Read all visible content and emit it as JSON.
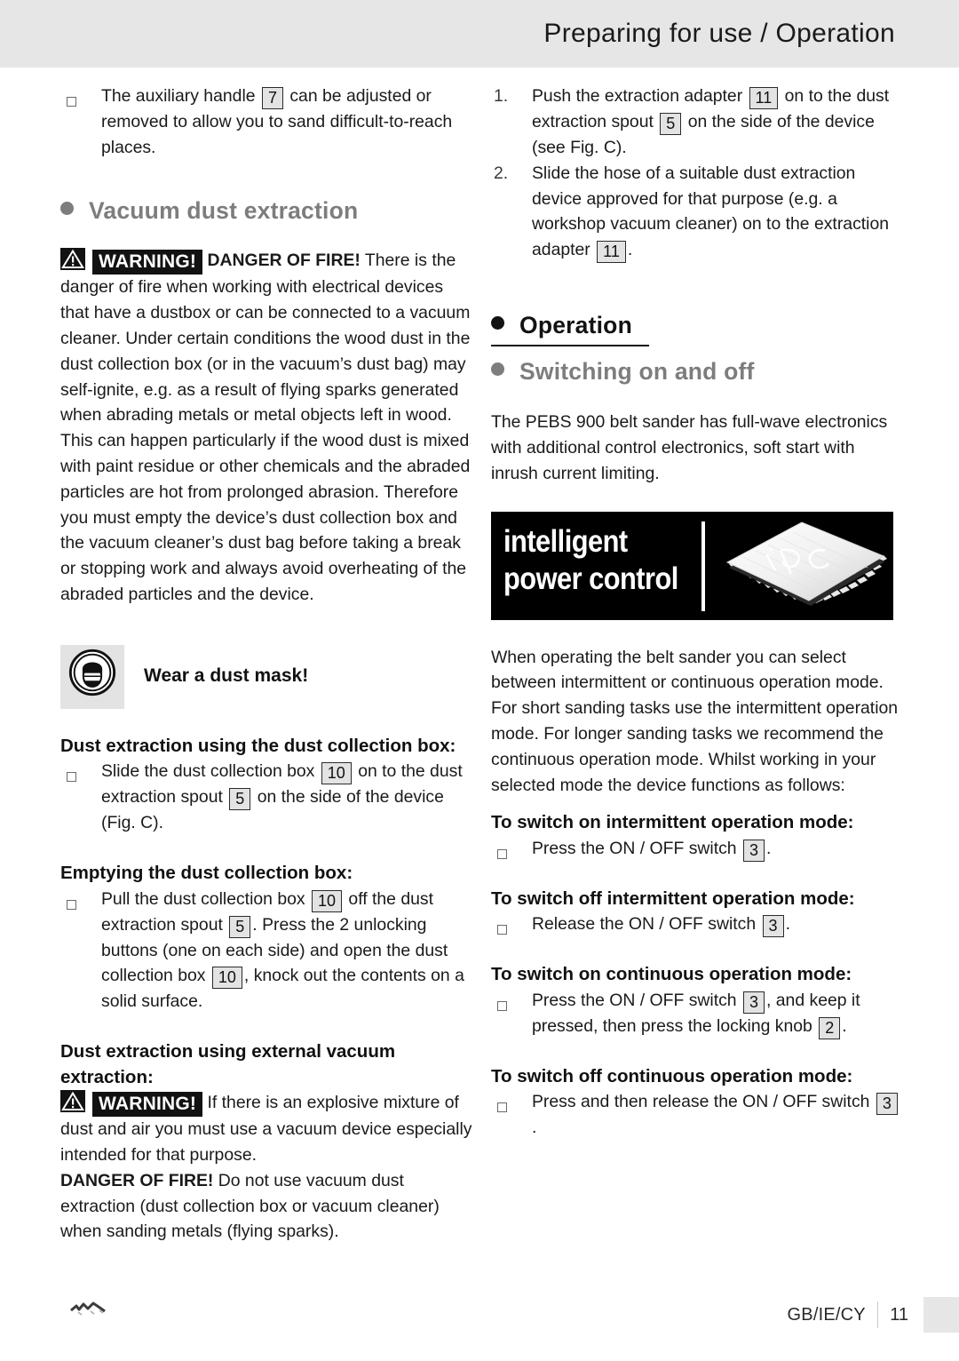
{
  "header": {
    "title": "Preparing for use / Operation"
  },
  "colors": {
    "header_band": "#e6e6e6",
    "heading_gray": "#7d7d7d",
    "heading_black": "#121212",
    "refbox_fill": "#e3e3e3",
    "warning_tag_bg": "#121212",
    "logo_bg": "#000000"
  },
  "left_column": {
    "bullet_auxiliary_handle": {
      "marker": "square-bullet",
      "text_1": "The auxiliary handle",
      "ref_1": "7",
      "text_2": "can be adjusted or removed to allow you to sand difficult-to-reach places."
    },
    "heading_vacuum_dust_extraction": "Vacuum dust extraction",
    "warning_fire": {
      "icon": "warning-triangle-icon",
      "tag": "WARNING!",
      "lead": "DANGER OF FIRE!",
      "body": "There is the danger of fire when working with electrical devices that have a dustbox or can be connected to a vacuum cleaner. Under certain conditions the wood dust in the dust collection box (or in the vacuum’s dust bag) may self-ignite, e.g. as a result of flying sparks generated when abrading metals or metal objects left in wood. This can happen particularly if the wood dust is mixed with paint residue or other chemicals and the abraded particles are hot from prolonged abrasion. Therefore you must empty the device’s dust collection box and the vacuum cleaner’s dust bag before taking a break or stopping work and always avoid overheating of the abraded particles and the device."
    },
    "dust_mask": {
      "icon": "dust-mask-pictogram-icon",
      "label": "Wear a dust mask!"
    },
    "heading_dust_collection_box": "Dust extraction using the dust collection box:",
    "bullet_slide_box": {
      "text_1": "Slide the dust collection box",
      "ref_1": "10",
      "text_2": "on to the dust extraction spout",
      "ref_2": "5",
      "text_3": "on the side of the device (Fig. C)."
    },
    "heading_emptying_box": "Emptying the dust collection box:",
    "bullet_pull_box": {
      "text_1": "Pull the dust collection box",
      "ref_1": "10",
      "text_2": "off the dust extraction spout",
      "ref_2": "5",
      "text_3": ". Press the 2 unlocking buttons (one on each side) and open the dust collection box",
      "ref_3": "10",
      "text_4": ", knock out the contents on a solid surface."
    },
    "heading_external_vacuum": "Dust extraction using external vacuum extraction:",
    "warning_explosive": {
      "icon": "warning-triangle-icon",
      "tag": "WARNING!",
      "body": "If there is an explosive mixture of dust and air you must use a vacuum device especially intended for that purpose."
    },
    "danger_fire_note": {
      "lead": "DANGER OF FIRE!",
      "body": "Do not use vacuum dust extraction (dust collection box or vacuum cleaner) when sanding metals (flying sparks)."
    }
  },
  "right_column": {
    "step_1": {
      "marker": "1.",
      "text_1": "Push the extraction adapter",
      "ref_1": "11",
      "text_2": "on to the dust extraction spout",
      "ref_2": "5",
      "text_3": "on the side of the device (see Fig. C)."
    },
    "step_2": {
      "marker": "2.",
      "text_1": "Slide the hose of a suitable dust extraction device approved for that purpose (e.g. a workshop vacuum cleaner) on to the extraction adapter",
      "ref_1": "11",
      "text_2": "."
    },
    "heading_operation": "Operation",
    "heading_switching": "Switching on and off",
    "intro_paragraph": "The PEBS 900 belt sander has full-wave electronics with additional control electronics, soft start with inrush current limiting.",
    "logo": {
      "line_1": "intelligent",
      "line_2": "power control",
      "chip_label": "ipc",
      "alt": "intelligent-power-control-logo"
    },
    "mode_paragraph": "When operating the belt sander you can select between intermittent or continuous operation mode. For short sanding tasks use the intermittent operation mode. For longer sanding tasks we recommend the continuous operation mode. Whilst working in your selected mode the device functions as follows:",
    "heading_on_intermittent": "To switch on intermittent operation mode:",
    "bullet_on_intermittent": {
      "text_1": "Press the ON / OFF switch",
      "ref_1": "3",
      "text_2": "."
    },
    "heading_off_intermittent": "To switch off intermittent operation mode:",
    "bullet_off_intermittent": {
      "text_1": "Release the ON / OFF switch",
      "ref_1": "3",
      "text_2": "."
    },
    "heading_on_continuous": "To switch on continuous operation mode:",
    "bullet_on_continuous": {
      "text_1": "Press the ON / OFF switch",
      "ref_1": "3",
      "text_2": ", and keep it pressed, then press the locking knob",
      "ref_2": "2",
      "text_3": "."
    },
    "heading_off_continuous": "To switch off continuous operation mode:",
    "bullet_off_continuous": {
      "text_1": "Press and then release the ON / OFF switch",
      "ref_1": "3",
      "text_2": "."
    }
  },
  "footer": {
    "locale": "GB/IE/CY",
    "page_number": "11"
  }
}
